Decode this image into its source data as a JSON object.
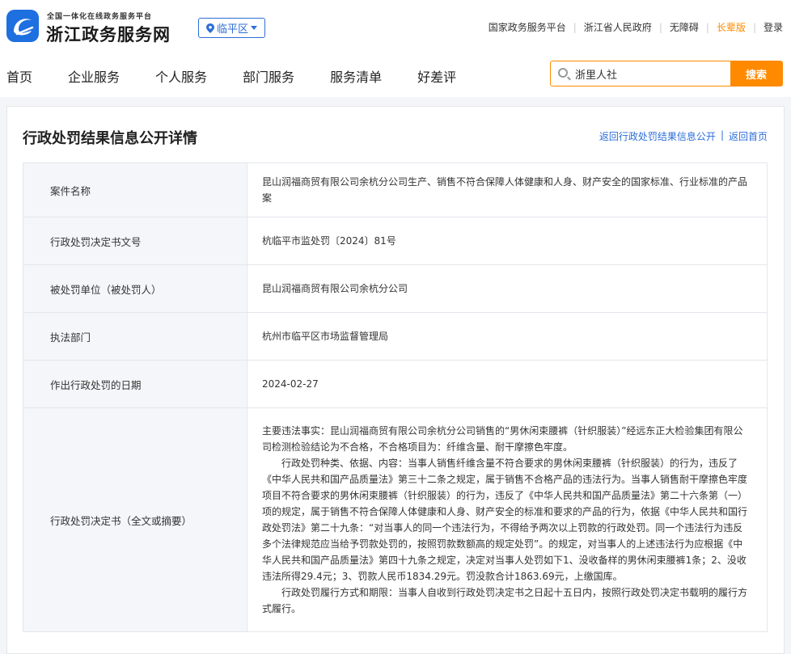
{
  "header": {
    "slogan": "全国一体化在线政务服务平台",
    "site_name": "浙江政务服务网",
    "region": "临平区",
    "links": [
      "国家政务服务平台",
      "浙江省人民政府",
      "无障碍",
      "长辈版",
      "登录"
    ]
  },
  "nav": {
    "items": [
      "首页",
      "企业服务",
      "个人服务",
      "部门服务",
      "服务清单",
      "好差评"
    ],
    "search_value": "浙里人社",
    "search_button": "搜索"
  },
  "detail": {
    "title": "行政处罚结果信息公开详情",
    "back_list": "返回行政处罚结果信息公开",
    "back_home": "返回首页",
    "rows": [
      {
        "label": "案件名称",
        "value": "昆山润福商贸有限公司余杭分公司生产、销售不符合保障人体健康和人身、财产安全的国家标准、行业标准的产品案"
      },
      {
        "label": "行政处罚决定书文号",
        "value": "杭临平市监处罚〔2024〕81号"
      },
      {
        "label": "被处罚单位（被处罚人）",
        "value": "昆山润福商贸有限公司余杭分公司"
      },
      {
        "label": "执法部门",
        "value": "杭州市临平区市场监督管理局"
      },
      {
        "label": "作出行政处罚的日期",
        "value": "2024-02-27"
      }
    ],
    "decision_label": "行政处罚决定书（全文或摘要）",
    "decision_paragraphs": [
      "主要违法事实：昆山润福商贸有限公司余杭分公司销售的“男休闲束腰裤（针织服装）”经远东正大检验集团有限公司检测检验结论为不合格，不合格项目为：纤维含量、耐干摩擦色牢度。",
      "行政处罚种类、依据、内容：当事人销售纤维含量不符合要求的男休闲束腰裤（针织服装）的行为，违反了《中华人民共和国产品质量法》第三十二条之规定，属于销售不合格产品的违法行为。当事人销售耐干摩擦色牢度项目不符合要求的男休闲束腰裤（针织服装）的行为，违反了《中华人民共和国产品质量法》第二十六条第（一）项的规定，属于销售不符合保障人体健康和人身、财产安全的标准和要求的产品的行为，依据《中华人民共和国行政处罚法》第二十九条：“对当事人的同一个违法行为，不得给予两次以上罚款的行政处罚。同一个违法行为违反多个法律规范应当给予罚款处罚的，按照罚款数额高的规定处罚”。的规定，对当事人的上述违法行为应根据《中华人民共和国产品质量法》第四十九条之规定，决定对当事人处罚如下1、没收备样的男休闲束腰裤1条；2、没收违法所得29.4元；3、罚款人民币1834.29元。罚没款合计1863.69元，上缴国库。",
      "行政处罚履行方式和期限：当事人自收到行政处罚决定书之日起十五日内，按照行政处罚决定书载明的履行方式履行。"
    ]
  }
}
